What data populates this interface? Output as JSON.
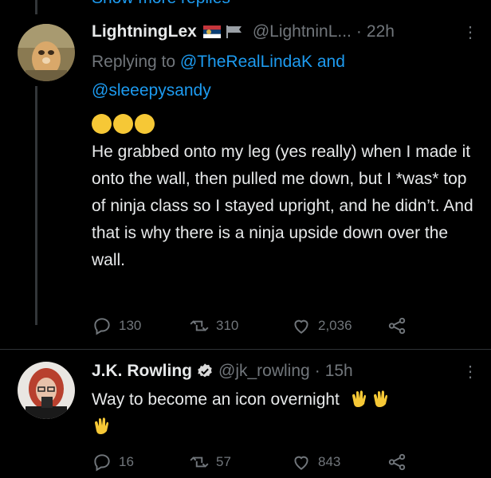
{
  "show_more": "Show more replies",
  "tweets": [
    {
      "name": "LightningLex",
      "handle": "@LightninL...",
      "sep": "·",
      "time": "22h",
      "more": "⋮",
      "replying_prefix": "Replying to",
      "reply_targets": [
        "@TheRealLindaK",
        "and",
        "@sleeepysandy"
      ],
      "emoji_line": [
        "rolling-laughing",
        "rolling-laughing",
        "rolling-laughing"
      ],
      "text": "He grabbed onto my leg (yes really) when I made it onto the wall, then pulled me down, but I *was* top of ninja class so I stayed upright, and he didn’t. And that is why there is a ninja upside down over the wall.",
      "replies": "130",
      "retweets": "310",
      "likes": "2,036"
    },
    {
      "name": "J.K. Rowling",
      "verified": true,
      "handle": "@jk_rowling",
      "sep": "·",
      "time": "15h",
      "more": "⋮",
      "text": "Way to become an icon overnight",
      "replies": "16",
      "retweets": "57",
      "likes": "843"
    }
  ],
  "colors": {
    "background": "#000000",
    "accent": "#1d9bf0",
    "muted": "#71767b",
    "text": "#e7e9ea"
  }
}
